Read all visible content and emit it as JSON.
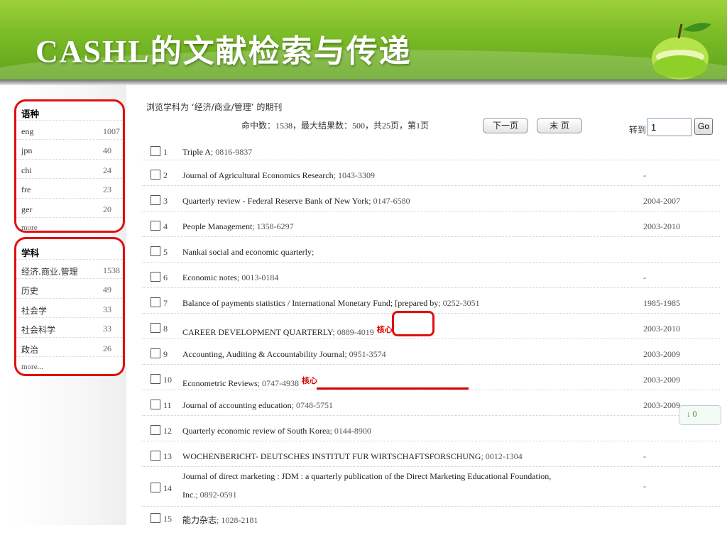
{
  "slide": {
    "title": "CASHL的文献检索与传递"
  },
  "facets": {
    "language": {
      "heading": "语种",
      "items": [
        {
          "name": "eng",
          "count": "1007"
        },
        {
          "name": "jpn",
          "count": "40"
        },
        {
          "name": "chi",
          "count": "24"
        },
        {
          "name": "fre",
          "count": "23"
        },
        {
          "name": "ger",
          "count": "20"
        }
      ],
      "more": "more"
    },
    "subject": {
      "heading": "学科",
      "items": [
        {
          "name": "经济.商业.管理",
          "count": "1538"
        },
        {
          "name": "历史",
          "count": "49"
        },
        {
          "name": "社会学",
          "count": "33"
        },
        {
          "name": "社会科学",
          "count": "33"
        },
        {
          "name": "政治",
          "count": "26"
        }
      ],
      "more": "more..."
    }
  },
  "results": {
    "caption": "浏览学科为 ‘经济/商业/管理’ 的期刊",
    "summary": "命中数：1538，最大结果数：500，共25页，第1页",
    "next_page": "下一页",
    "last_page": "末 页",
    "goto_label": "转到",
    "goto_value": "1",
    "go_button": "Go",
    "core_tag": "核心",
    "rows": [
      {
        "num": "1",
        "title": "Triple A",
        "issn": "; 0816-9837",
        "years": ""
      },
      {
        "num": "2",
        "title": "Journal of Agricultural Economics Research",
        "issn": "; 1043-3309",
        "years": "-"
      },
      {
        "num": "3",
        "title": "Quarterly review - Federal Reserve Bank of New York",
        "issn": "; 0147-6580",
        "years": "2004-2007"
      },
      {
        "num": "4",
        "title": "People Management",
        "issn": "; 1358-6297",
        "years": "2003-2010"
      },
      {
        "num": "5",
        "title": "Nankai social and economic quarterly",
        "issn": ";",
        "years": ""
      },
      {
        "num": "6",
        "title": "Economic notes",
        "issn": "; 0013-0184",
        "years": "-"
      },
      {
        "num": "7",
        "title": "Balance of payments statistics / International Monetary Fund; [prepared by",
        "issn": "; 0252-3051",
        "years": "1985-1985"
      },
      {
        "num": "8",
        "title": "CAREER DEVELOPMENT QUARTERLY",
        "issn": "; 0889-4019",
        "years": "2003-2010",
        "core": true
      },
      {
        "num": "9",
        "title": "Accounting, Auditing & Accountability Journal",
        "issn": "; 0951-3574",
        "years": "2003-2009"
      },
      {
        "num": "10",
        "title": "Econometric Reviews",
        "issn": "; 0747-4938",
        "years": "2003-2009",
        "core": true
      },
      {
        "num": "11",
        "title": "Journal of accounting education",
        "issn": "; 0748-5751",
        "years": "2003-2009"
      },
      {
        "num": "12",
        "title": "Quarterly economic review of South Korea",
        "issn": "; 0144-8900",
        "years": ""
      },
      {
        "num": "13",
        "title": "WOCHENBERICHT- DEUTSCHES INSTITUT FUR WIRTSCHAFTSFORSCHUNG",
        "issn": "; 0012-1304",
        "years": "-"
      },
      {
        "num": "14",
        "title": "Journal of direct marketing : JDM : a quarterly publication of the Direct Marketing Educational Foundation,",
        "title2": "Inc.",
        "issn": "; 0892-0591",
        "years": "-"
      },
      {
        "num": "15",
        "title": "能力杂志",
        "issn": "; 1028-2181",
        "years": ""
      }
    ]
  },
  "download_badge": "↓  0",
  "colors": {
    "header_green": "#7dbd28",
    "annotation_red": "#e01010"
  },
  "icons": [
    "apple-icon",
    "checkbox-icon",
    "arrow-down-icon"
  ]
}
